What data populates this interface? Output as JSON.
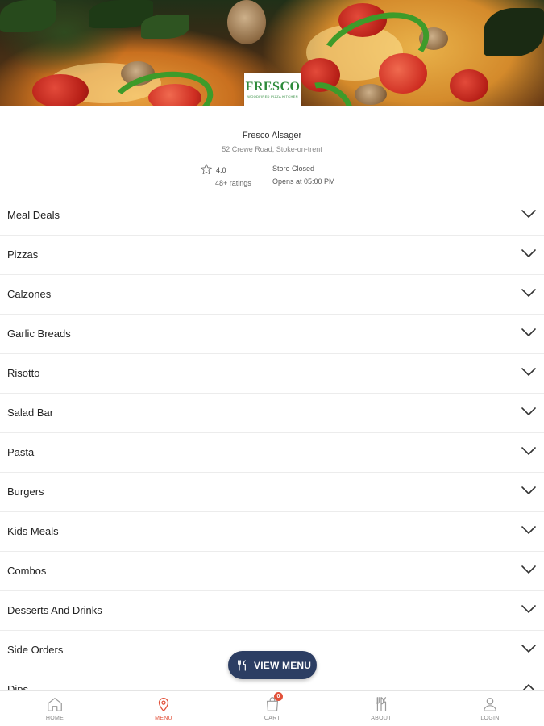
{
  "store": {
    "logo_text": "FRESCO",
    "logo_subtext": "WOODFIRED PIZZA KITCHEN",
    "name": "Fresco Alsager",
    "address": "52 Crewe Road, Stoke-on-trent",
    "rating": "4.0",
    "rating_count": "48+ ratings",
    "status": "Store Closed",
    "opens_at": "Opens at 05:00 PM"
  },
  "categories": [
    {
      "label": "Meal Deals",
      "expanded": false
    },
    {
      "label": "Pizzas",
      "expanded": false
    },
    {
      "label": "Calzones",
      "expanded": false
    },
    {
      "label": "Garlic Breads",
      "expanded": false
    },
    {
      "label": "Risotto",
      "expanded": false
    },
    {
      "label": "Salad Bar",
      "expanded": false
    },
    {
      "label": "Pasta",
      "expanded": false
    },
    {
      "label": "Burgers",
      "expanded": false
    },
    {
      "label": "Kids Meals",
      "expanded": false
    },
    {
      "label": "Combos",
      "expanded": false
    },
    {
      "label": "Desserts And Drinks",
      "expanded": false
    },
    {
      "label": "Side Orders",
      "expanded": false
    },
    {
      "label": "Dips",
      "expanded": true
    }
  ],
  "view_menu": {
    "label": "VIEW MENU",
    "icon": "cutlery-icon",
    "color": "#2c3e63"
  },
  "bottom_nav": {
    "active_color": "#e2513a",
    "items": [
      {
        "label": "HOME",
        "icon": "home-icon"
      },
      {
        "label": "MENU",
        "icon": "location-pin-icon",
        "active": true
      },
      {
        "label": "CART",
        "icon": "shopping-bag-icon",
        "badge": "0"
      },
      {
        "label": "ABOUT",
        "icon": "cutlery-icon"
      },
      {
        "label": "LOGIN",
        "icon": "user-icon"
      }
    ]
  }
}
